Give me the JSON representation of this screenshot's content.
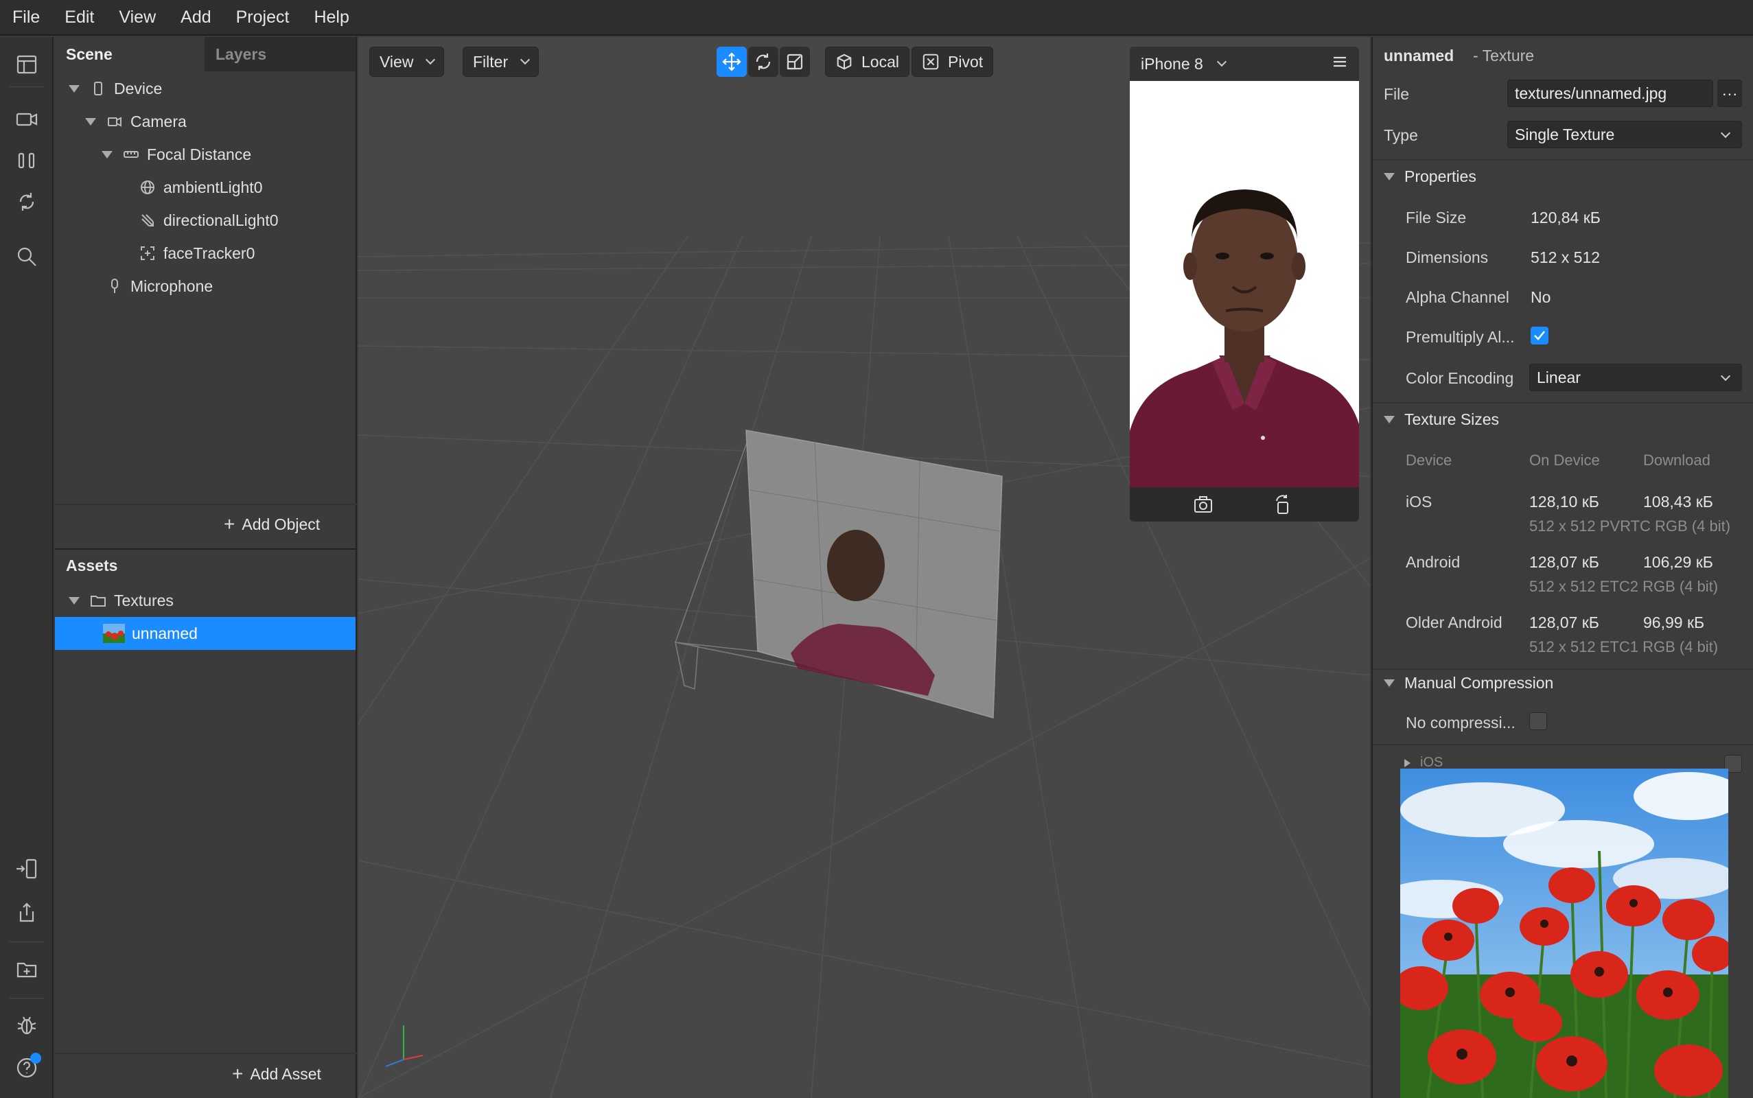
{
  "menu": [
    "File",
    "Edit",
    "View",
    "Add",
    "Project",
    "Help"
  ],
  "scene": {
    "tabs": {
      "scene": "Scene",
      "layers": "Layers"
    },
    "tree": {
      "device": "Device",
      "camera": "Camera",
      "focal": "Focal Distance",
      "ambient": "ambientLight0",
      "directional": "directionalLight0",
      "facetracker": "faceTracker0",
      "microphone": "Microphone"
    },
    "add_object": "Add Object"
  },
  "assets": {
    "title": "Assets",
    "folder": "Textures",
    "item": "unnamed",
    "add_asset": "Add Asset"
  },
  "viewport": {
    "view_label": "View",
    "filter_label": "Filter",
    "local_label": "Local",
    "pivot_label": "Pivot",
    "device_name": "iPhone 8"
  },
  "inspector": {
    "name": "unnamed",
    "type_suffix": "- Texture",
    "file_label": "File",
    "file_value": "textures/unnamed.jpg",
    "file_more": "···",
    "type_label": "Type",
    "type_value": "Single Texture",
    "properties": {
      "header": "Properties",
      "file_size_label": "File Size",
      "file_size": "120,84 кБ",
      "dimensions_label": "Dimensions",
      "dimensions": "512 x 512",
      "alpha_label": "Alpha Channel",
      "alpha": "No",
      "premultiply_label": "Premultiply Al...",
      "premultiply_checked": true,
      "encoding_label": "Color Encoding",
      "encoding": "Linear"
    },
    "texture_sizes": {
      "header": "Texture Sizes",
      "col_device": "Device",
      "col_on_device": "On Device",
      "col_download": "Download",
      "rows": [
        {
          "device": "iOS",
          "on_device": "128,10 кБ",
          "download": "108,43 кБ",
          "detail": "512 x 512 PVRTC RGB (4 bit)"
        },
        {
          "device": "Android",
          "on_device": "128,07 кБ",
          "download": "106,29 кБ",
          "detail": "512 x 512 ETC2 RGB (4 bit)"
        },
        {
          "device": "Older Android",
          "on_device": "128,07 кБ",
          "download": "96,99 кБ",
          "detail": "512 x 512 ETC1 RGB (4 bit)"
        }
      ]
    },
    "manual_compression": {
      "header": "Manual Compression",
      "no_compression_label": "No compressi...",
      "no_compression_checked": false,
      "ios_label": "iOS"
    }
  },
  "colors": {
    "accent": "#1a8cff",
    "panel": "#3b3b3b",
    "viewport": "#474747",
    "shirt": "#6b1a36",
    "poppy": "#d8261a",
    "sky": "#4a9be0"
  },
  "icons": {
    "rail": [
      "layout-icon",
      "video-icon",
      "columns-icon",
      "sync-icon",
      "search-icon",
      "device-link-icon",
      "share-icon",
      "add-folder-icon",
      "bug-icon",
      "help-icon"
    ]
  }
}
